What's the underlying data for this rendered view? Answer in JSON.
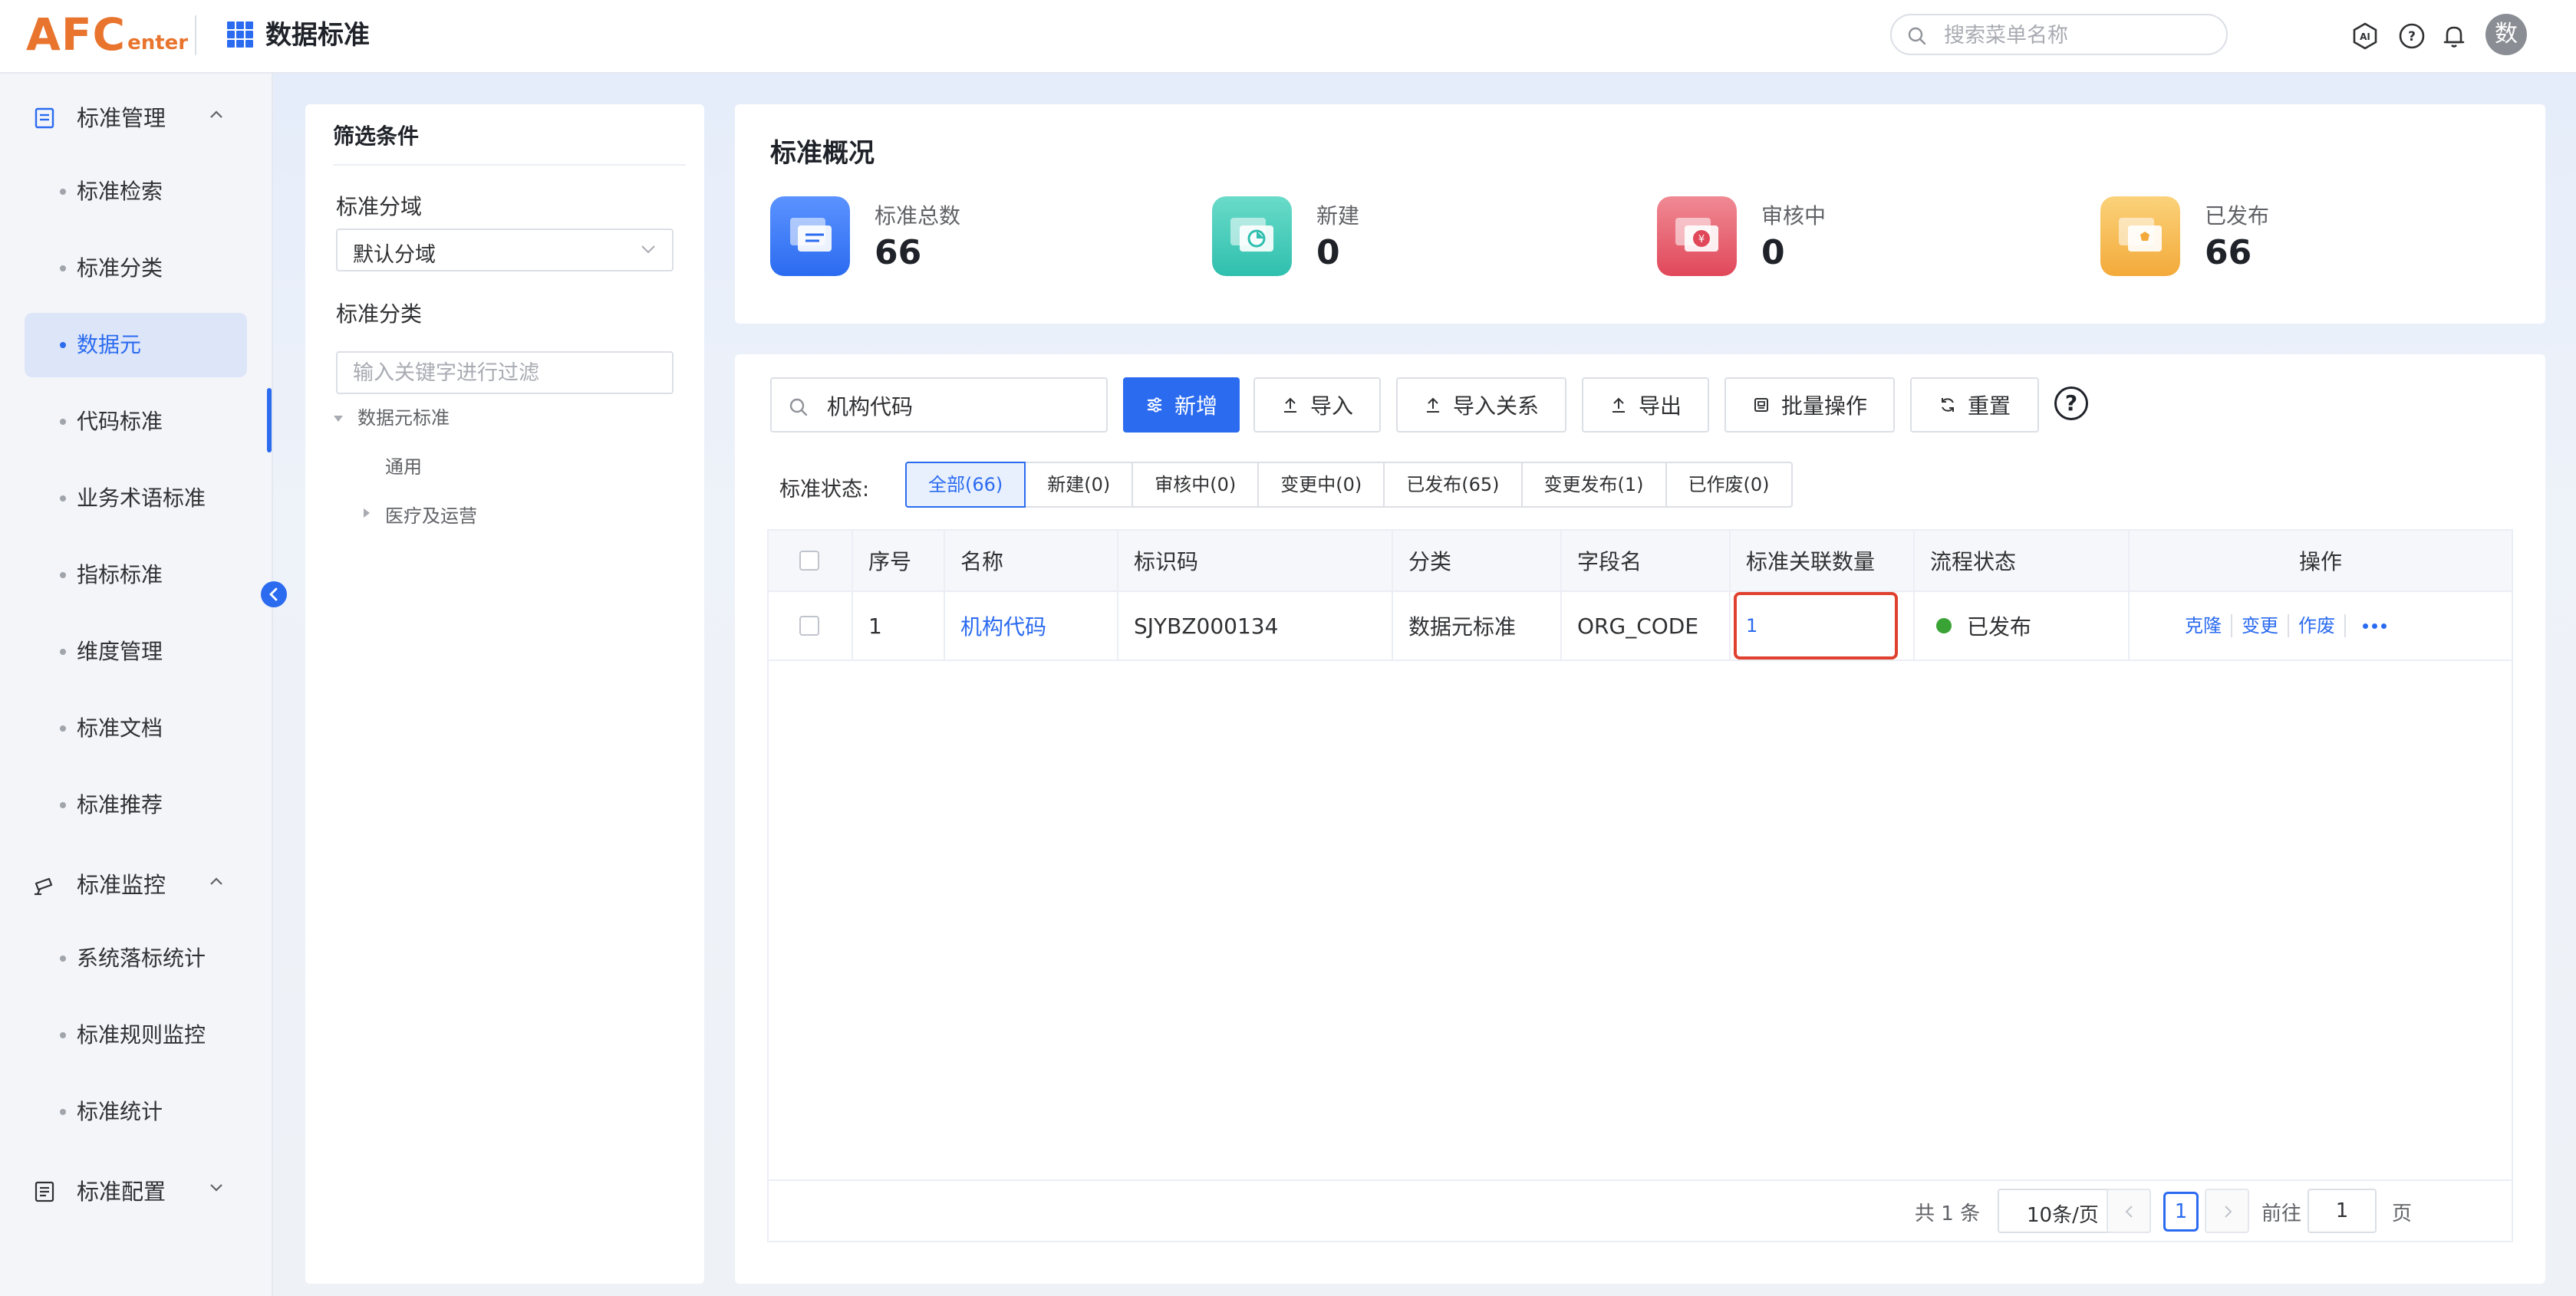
{
  "header": {
    "logo_main": "AFC",
    "logo_sub": "enter",
    "app_title": "数据标准",
    "search_placeholder": "搜索菜单名称",
    "avatar_text": "数"
  },
  "sidebar": {
    "groups": [
      {
        "label": "标准管理",
        "expanded": true
      },
      {
        "label": "标准监控",
        "expanded": true
      },
      {
        "label": "标准配置",
        "expanded": false
      }
    ],
    "items": [
      {
        "label": "标准检索"
      },
      {
        "label": "标准分类"
      },
      {
        "label": "数据元",
        "active": true
      },
      {
        "label": "代码标准"
      },
      {
        "label": "业务术语标准"
      },
      {
        "label": "指标标准"
      },
      {
        "label": "维度管理"
      },
      {
        "label": "标准文档"
      },
      {
        "label": "标准推荐"
      },
      {
        "label": "系统落标统计"
      },
      {
        "label": "标准规则监控"
      },
      {
        "label": "标准统计"
      }
    ]
  },
  "filter": {
    "title": "筛选条件",
    "domain_label": "标准分域",
    "domain_value": "默认分域",
    "category_label": "标准分类",
    "keyword_placeholder": "输入关键字进行过滤",
    "tree": {
      "root": "数据元标准",
      "children": [
        "通用",
        "医疗及运营"
      ]
    }
  },
  "overview": {
    "title": "标准概况",
    "stats": [
      {
        "label": "标准总数",
        "value": "66",
        "color": "#2b6bf0"
      },
      {
        "label": "新建",
        "value": "0",
        "color": "#3cc9b9"
      },
      {
        "label": "审核中",
        "value": "0",
        "color": "#e4505f"
      },
      {
        "label": "已发布",
        "value": "66",
        "color": "#f5b43f"
      }
    ]
  },
  "toolbar": {
    "search_value": "机构代码",
    "add": "新增",
    "import": "导入",
    "import_relation": "导入关系",
    "export": "导出",
    "batch": "批量操作",
    "reset": "重置",
    "help": "?"
  },
  "status": {
    "label": "标准状态:",
    "tabs": [
      {
        "label": "全部(66)",
        "active": true
      },
      {
        "label": "新建(0)"
      },
      {
        "label": "审核中(0)"
      },
      {
        "label": "变更中(0)"
      },
      {
        "label": "已发布(65)"
      },
      {
        "label": "变更发布(1)"
      },
      {
        "label": "已作废(0)"
      }
    ]
  },
  "table": {
    "columns": [
      "序号",
      "名称",
      "标识码",
      "分类",
      "字段名",
      "标准关联数量",
      "流程状态",
      "操作"
    ],
    "rows": [
      {
        "index": "1",
        "name": "机构代码",
        "code": "SJYBZ000134",
        "category": "数据元标准",
        "field": "ORG_CODE",
        "relation_count": "1",
        "status": "已发布",
        "status_color": "#3aa335",
        "actions": [
          "克隆",
          "变更",
          "作废"
        ]
      }
    ]
  },
  "pagination": {
    "total": "共 1 条",
    "page_size": "10条/页",
    "current": "1",
    "goto": "前往",
    "goto_value": "1",
    "page_suffix": "页"
  }
}
